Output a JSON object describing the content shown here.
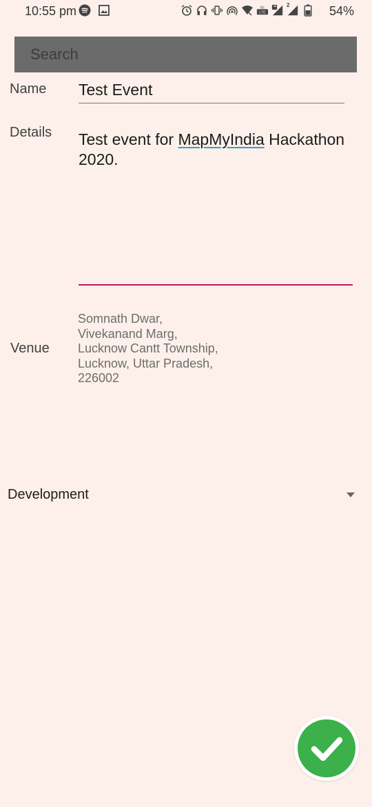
{
  "status_bar": {
    "time": "10:55 pm",
    "battery": "54%",
    "left_icons": [
      "spotify-icon",
      "image-icon"
    ],
    "right_icons": [
      "alarm-icon",
      "headset-icon",
      "vibrate-icon",
      "hotspot-icon",
      "wifi-icon",
      "volte-icon",
      "signal-icon",
      "signal-icon",
      "battery-icon"
    ],
    "sim1_badge": "1",
    "sim2_badge": "2"
  },
  "search": {
    "placeholder": "Search"
  },
  "form": {
    "name_label": "Name",
    "name_value": "Test Event",
    "details_label": "Details",
    "details_text_before": "Test event for ",
    "details_text_flagged": "MapMyIndia",
    "details_text_after": " Hackathon 2020.",
    "venue_label": "Venue",
    "venue_lines": [
      "Somnath Dwar,",
      "Vivekanand Marg,",
      "Lucknow Cantt Township,",
      "Lucknow, Uttar Pradesh,",
      "226002"
    ],
    "category_value": "Development"
  },
  "colors": {
    "background": "#fdf0ea",
    "search_bg": "#6b6b6b",
    "focus_underline": "#c2185b",
    "fab_green": "#3cb04a"
  }
}
